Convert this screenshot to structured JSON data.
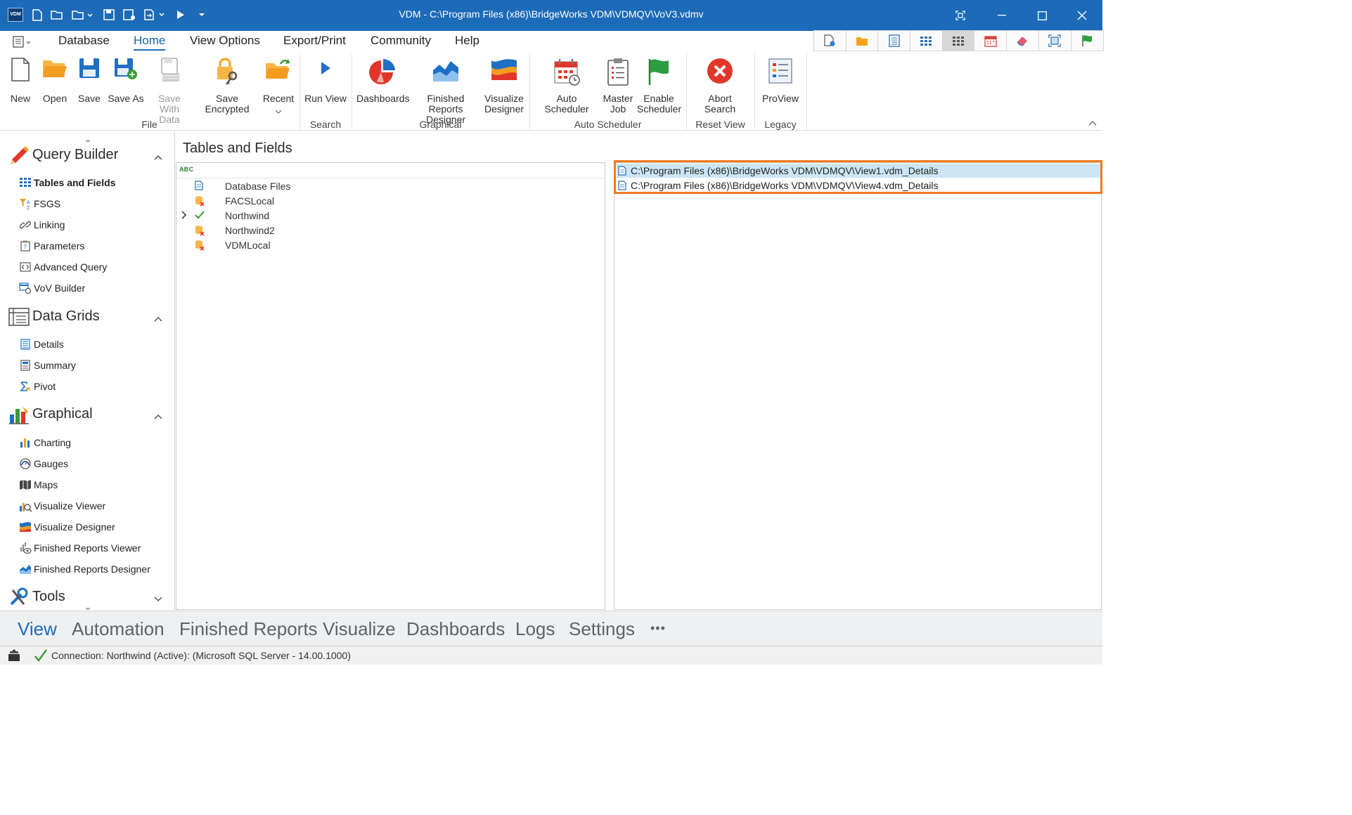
{
  "window": {
    "title": "VDM - C:\\Program Files (x86)\\BridgeWorks VDM\\VDMQV\\VoV3.vdmv",
    "logo_text": "VDM"
  },
  "ribbon_tabs": [
    "Database",
    "Home",
    "View Options",
    "Export/Print",
    "Community",
    "Help"
  ],
  "ribbon": {
    "buttons": {
      "new": "New",
      "open": "Open",
      "save": "Save",
      "save_as": "Save As",
      "save_with_data_1": "Save With",
      "save_with_data_2": "Data",
      "save_encrypted": "Save Encrypted",
      "recent": "Recent",
      "run_view": "Run View",
      "dashboards": "Dashboards",
      "finished_reports_1": "Finished Reports",
      "finished_reports_2": "Designer",
      "visualize_1": "Visualize",
      "visualize_2": "Designer",
      "auto_scheduler": "Auto Scheduler",
      "master_job_1": "Master",
      "master_job_2": "Job",
      "enable_scheduler_1": "Enable",
      "enable_scheduler_2": "Scheduler",
      "abort_search_1": "Abort",
      "abort_search_2": "Search",
      "proview": "ProView"
    },
    "groups": {
      "file": "File",
      "search": "Search",
      "graphical": "Graphical",
      "auto_scheduler": "Auto Scheduler",
      "reset_view": "Reset View",
      "legacy": "Legacy"
    }
  },
  "leftnav": {
    "groups": {
      "query_builder": "Query Builder",
      "data_grids": "Data Grids",
      "graphical": "Graphical",
      "tools": "Tools"
    },
    "items": {
      "tables_and_fields": "Tables and Fields",
      "fsgs": "FSGS",
      "linking": "Linking",
      "parameters": "Parameters",
      "advanced_query": "Advanced Query",
      "vov_builder": "VoV Builder",
      "details": "Details",
      "summary": "Summary",
      "pivot": "Pivot",
      "charting": "Charting",
      "gauges": "Gauges",
      "maps": "Maps",
      "visualize_viewer": "Visualize Viewer",
      "visualize_designer": "Visualize Designer",
      "finished_reports_viewer": "Finished Reports Viewer",
      "finished_reports_designer": "Finished Reports Designer"
    }
  },
  "main": {
    "title": "Tables and Fields",
    "tree": [
      "Database Files",
      "FACSLocal",
      "Northwind",
      "Northwind2",
      "VDMLocal"
    ],
    "files": [
      "C:\\Program Files (x86)\\BridgeWorks VDM\\VDMQV\\View1.vdm_Details",
      "C:\\Program Files (x86)\\BridgeWorks VDM\\VDMQV\\View4.vdm_Details"
    ]
  },
  "bottomnav": [
    "View",
    "Automation",
    "Finished Reports",
    "Visualize",
    "Dashboards",
    "Logs",
    "Settings",
    "•••"
  ],
  "status": {
    "connection": "Connection: Northwind (Active): (Microsoft SQL Server - 14.00.1000)"
  },
  "colors": {
    "titlebar": "#1c6bb8",
    "highlight": "#f07a1e",
    "selection": "#cde6f7",
    "active_accent": "#1c6bb8"
  }
}
